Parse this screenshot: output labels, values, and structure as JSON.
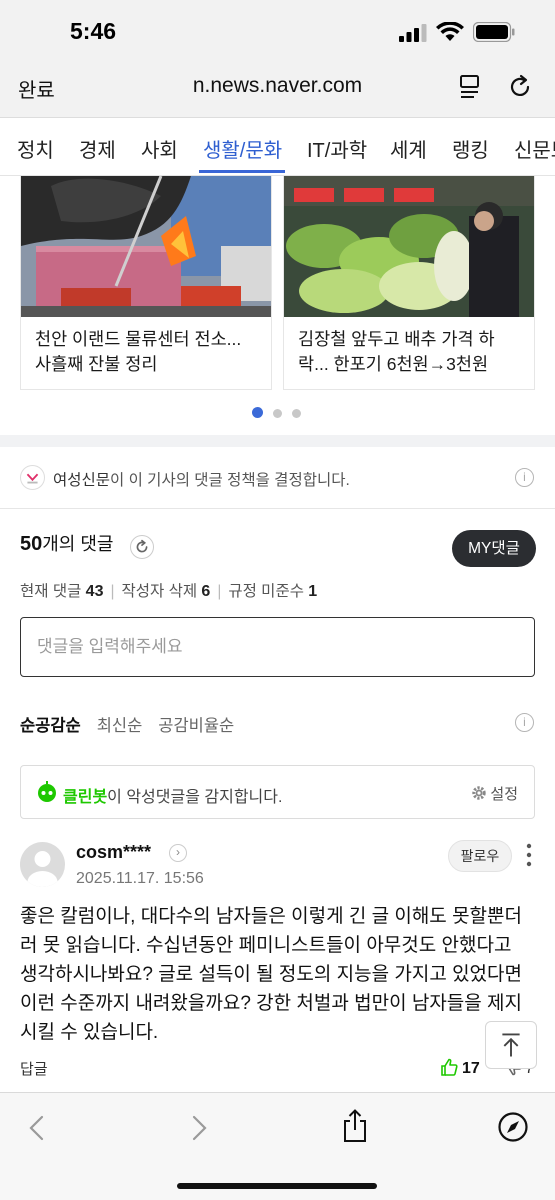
{
  "status": {
    "time": "5:46"
  },
  "browser": {
    "done_label": "완료",
    "url": "n.news.naver.com"
  },
  "tabs": [
    "정치",
    "경제",
    "사회",
    "생활/문화",
    "IT/과학",
    "세계",
    "랭킹",
    "신문보기"
  ],
  "active_tab": "생활/문화",
  "related_articles": [
    {
      "caption": "천안 이랜드 물류센터 전소...사흘째 잔불 정리"
    },
    {
      "caption": "김장철 앞두고 배추 가격 하락... 한포기 6천원→3천원"
    }
  ],
  "carousel": {
    "page": 1,
    "pages": 3
  },
  "policy": {
    "press": "여성신문",
    "text": "이 이 기사의 댓글 정책을 결정합니다."
  },
  "comments": {
    "count": "50",
    "count_label": "개의 댓글",
    "my_button": "MY댓글",
    "stats": [
      {
        "label": "현재 댓글",
        "value": "43"
      },
      {
        "label": "작성자 삭제",
        "value": "6"
      },
      {
        "label": "규정 미준수",
        "value": "1"
      }
    ],
    "input_placeholder": "댓글을 입력해주세요",
    "sort_options": [
      "순공감순",
      "최신순",
      "공감비율순"
    ],
    "active_sort": "순공감순"
  },
  "cleanbot": {
    "name": "클린봇",
    "text": "이 악성댓글을 감지합니다.",
    "settings_label": "설정"
  },
  "comment": {
    "user": "cosm****",
    "date": "2025.11.17. 15:56",
    "follow_label": "팔로우",
    "body": "좋은 칼럼이나, 대다수의 남자들은 이렇게 긴 글 이해도 못할뿐더러 못 읽습니다. 수십년동안 페미니스트들이 아무것도 안했다고 생각하시나봐요? 글로 설득이 될 정도의 지능을 가지고 있었다면 이런 수준까지 내려왔을까요? 강한 처벌과 법만이 남자들을 제지시킬 수 있습니다.",
    "reply_label": "답글",
    "likes": "17",
    "dislikes": "7"
  },
  "colors": {
    "accent": "#2f5fd0",
    "cleanbot_green": "#1ec800",
    "dark_button": "#2b2d31"
  }
}
